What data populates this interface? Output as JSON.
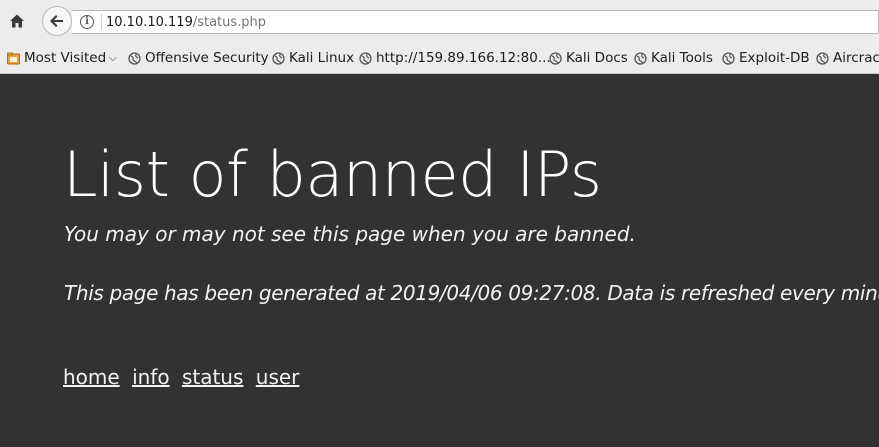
{
  "browser": {
    "url_host": "10.10.10.119",
    "url_path": "/status.php",
    "bookmarks": [
      {
        "label": "Most Visited",
        "icon": "folder-icon",
        "has_dropdown": true
      },
      {
        "label": "Offensive Security",
        "icon": "globe-icon"
      },
      {
        "label": "Kali Linux",
        "icon": "globe-icon"
      },
      {
        "label": "http://159.89.166.12:80...",
        "icon": "globe-icon"
      },
      {
        "label": "Kali Docs",
        "icon": "globe-icon"
      },
      {
        "label": "Kali Tools",
        "icon": "globe-icon"
      },
      {
        "label": "Exploit-DB",
        "icon": "globe-icon"
      },
      {
        "label": "Aircrack",
        "icon": "globe-icon"
      }
    ]
  },
  "page": {
    "title": "List of banned IPs",
    "subtitle": "You may or may not see this page when you are banned.",
    "generated": "This page has been generated at 2019/04/06 09:27:08. Data is refreshed every minute.",
    "links": [
      "home",
      "info",
      "status",
      "user"
    ]
  },
  "colors": {
    "background": "#323232",
    "text": "#ffffff",
    "chrome": "#ececec"
  }
}
